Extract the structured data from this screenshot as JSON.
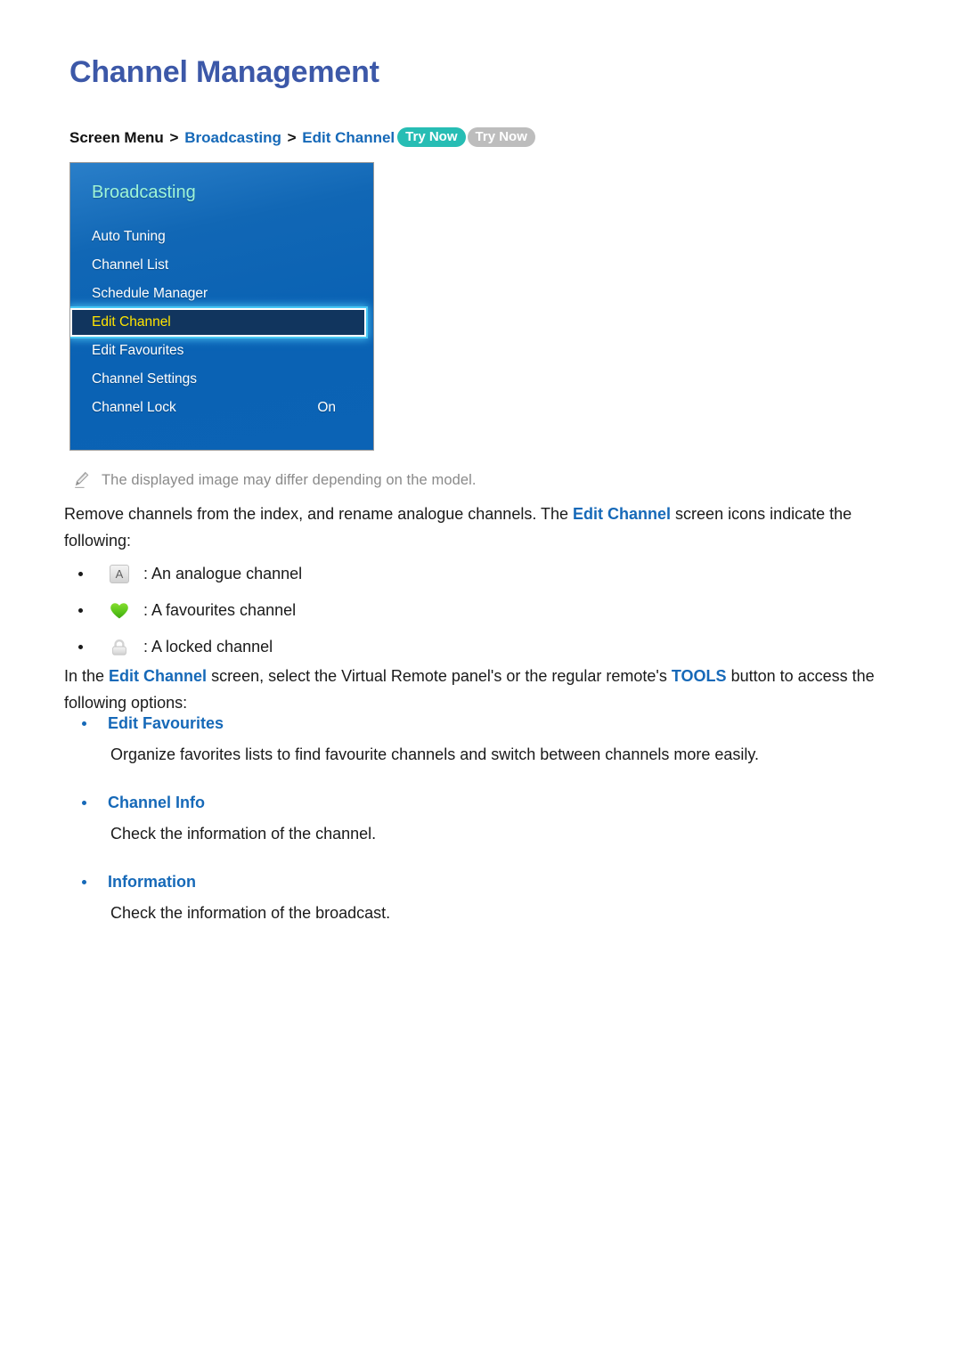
{
  "page": {
    "title": "Channel Management"
  },
  "breadcrumb": {
    "root": "Screen Menu",
    "separator": ">",
    "level1": "Broadcasting",
    "level2": "Edit Channel",
    "badge_primary": "Try Now",
    "badge_secondary": "Try Now",
    "badge_primary_color": "#27bdb4",
    "badge_secondary_color": "#bdbdbd"
  },
  "tv_menu": {
    "header": "Broadcasting",
    "header_color": "#9ff5d8",
    "panel_color": "#0a62b4",
    "selected_text_color": "#ffe400",
    "items": [
      {
        "label": "Auto Tuning",
        "value": "",
        "selected": false
      },
      {
        "label": "Channel List",
        "value": "",
        "selected": false
      },
      {
        "label": "Schedule Manager",
        "value": "",
        "selected": false
      },
      {
        "label": "Edit Channel",
        "value": "",
        "selected": true
      },
      {
        "label": "Edit Favourites",
        "value": "",
        "selected": false
      },
      {
        "label": "Channel Settings",
        "value": "",
        "selected": false
      },
      {
        "label": "Channel Lock",
        "value": "On",
        "selected": false
      }
    ]
  },
  "note": {
    "icon": "pencil-icon",
    "text": "The displayed image may differ depending on the model."
  },
  "paragraph_1": {
    "part1": "Remove channels from the index, and rename analogue channels. The ",
    "link": "Edit Channel",
    "part2": " screen icons indicate the following:"
  },
  "legend": {
    "items": [
      {
        "icon": "analogue-channel-icon",
        "glyph": "A",
        "label": ": An analogue channel"
      },
      {
        "icon": "favourite-heart-icon",
        "glyph": "",
        "label": ": A favourites channel"
      },
      {
        "icon": "locked-padlock-icon",
        "glyph": "",
        "label": ": A locked channel"
      }
    ]
  },
  "paragraph_2": {
    "part1": "In the ",
    "link1": "Edit Channel",
    "part2": " screen, select the Virtual Remote panel's or the regular remote's ",
    "link2": "TOOLS",
    "part3": " button to access the following options:"
  },
  "options": [
    {
      "title": "Edit Favourites",
      "description": "Organize favorites lists to find favourite channels and switch between channels more easily."
    },
    {
      "title": "Channel Info",
      "description": "Check the information of the channel."
    },
    {
      "title": "Information",
      "description": "Check the information of the broadcast."
    }
  ]
}
